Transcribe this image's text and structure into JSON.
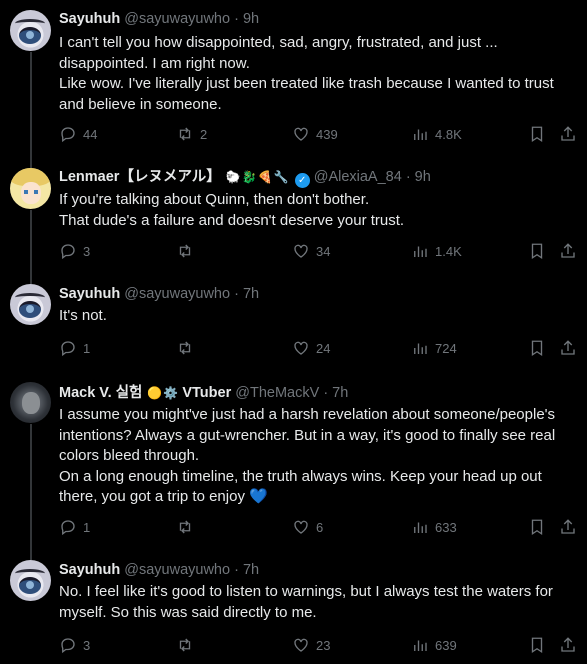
{
  "tweets": [
    {
      "name": "Sayuhuh",
      "handle": "@sayuwayuwho",
      "time": "· 9h",
      "body": [
        "I can't tell you how disappointed, sad, angry, frustrated, and just ... disappointed. I am right now.",
        "Like wow. I've literally just been treated like trash because I wanted to trust and believe in someone."
      ],
      "replies": "44",
      "reposts": "2",
      "likes": "439",
      "views": "4.8K"
    },
    {
      "name": "Lenmaer【レヌメアル】",
      "handle": "@AlexiaA_84",
      "time": "· 9h",
      "emojis": [
        "🐑",
        "🐉",
        "🍕",
        "🔧"
      ],
      "body": [
        "If you're talking about Quinn, then don't bother.",
        "That dude's a failure and doesn't deserve your trust."
      ],
      "replies": "3",
      "reposts": "",
      "likes": "34",
      "views": "1.4K"
    },
    {
      "name": "Sayuhuh",
      "handle": "@sayuwayuwho",
      "time": "· 7h",
      "body": [
        "It's not."
      ],
      "replies": "1",
      "reposts": "",
      "likes": "24",
      "views": "724"
    },
    {
      "name": "Mack V. 실험",
      "name_suffix": "VTuber",
      "handle": "@TheMackV",
      "time": "· 7h",
      "emojis": [
        "🟡",
        "⚙️"
      ],
      "body": [
        "I assume you might've just had a harsh revelation about someone/people's intentions? Always a gut-wrencher. But in a way, it's good to finally see real colors bleed through.",
        "On a long enough timeline, the truth always wins. Keep your head up out there, you got a trip to enjoy"
      ],
      "heart_emoji": "💙",
      "replies": "1",
      "reposts": "",
      "likes": "6",
      "views": "633"
    },
    {
      "name": "Sayuhuh",
      "handle": "@sayuwayuwho",
      "time": "· 7h",
      "body": [
        "No. I feel like it's good to listen to warnings, but I always test the waters for myself. So this was said directly to me."
      ],
      "replies": "3",
      "reposts": "",
      "likes": "23",
      "views": "639"
    }
  ],
  "icons": {
    "reply": "reply-icon",
    "repost": "repost-icon",
    "like": "heart-icon",
    "views": "views-icon",
    "bookmark": "bookmark-icon",
    "share": "share-icon"
  },
  "colors": {
    "background": "#000000",
    "text": "#e7e9ea",
    "muted": "#71767b",
    "verified": "#1d9bf0"
  }
}
